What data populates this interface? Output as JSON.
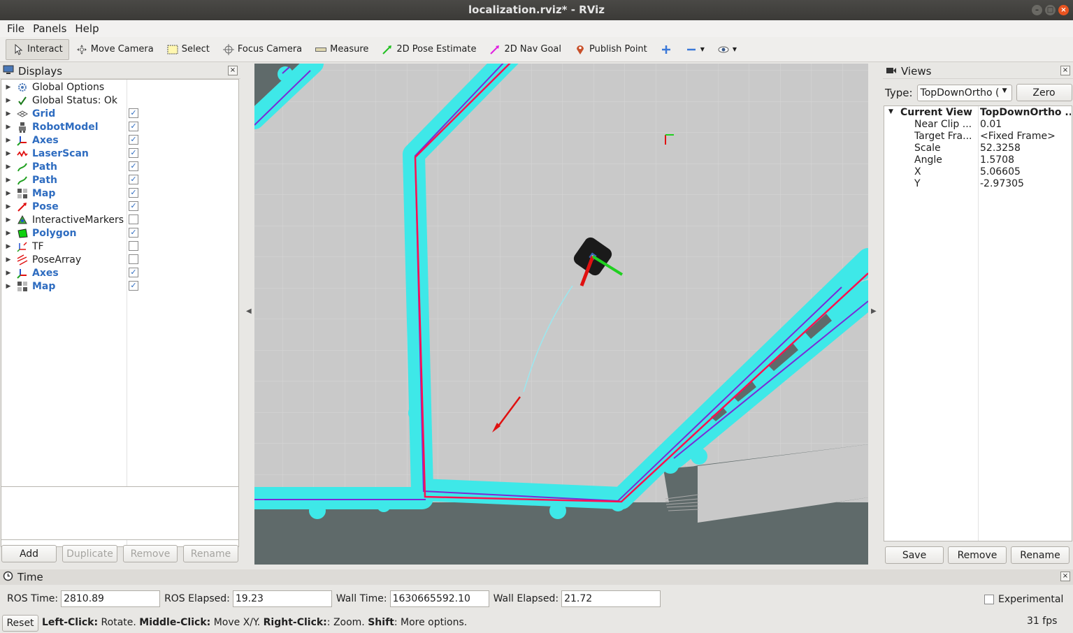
{
  "window": {
    "title": "localization.rviz* - RViz"
  },
  "menu": [
    "File",
    "Panels",
    "Help"
  ],
  "toolbar": {
    "tools": [
      {
        "label": "Interact",
        "icon": "cursor-icon",
        "active": true
      },
      {
        "label": "Move Camera",
        "icon": "move-camera-icon"
      },
      {
        "label": "Select",
        "icon": "select-box-icon"
      },
      {
        "label": "Focus Camera",
        "icon": "focus-camera-icon"
      },
      {
        "label": "Measure",
        "icon": "ruler-icon"
      },
      {
        "label": "2D Pose Estimate",
        "icon": "pose-estimate-arrow-icon"
      },
      {
        "label": "2D Nav Goal",
        "icon": "nav-goal-arrow-icon"
      },
      {
        "label": "Publish Point",
        "icon": "map-pin-icon"
      }
    ]
  },
  "displays": {
    "title": "Displays",
    "items": [
      {
        "label": "Global Options",
        "icon": "gear-icon",
        "bold": false,
        "checkbox": null
      },
      {
        "label": "Global Status: Ok",
        "icon": "check-icon",
        "bold": false,
        "checkbox": null
      },
      {
        "label": "Grid",
        "icon": "grid-icon",
        "bold": true,
        "checkbox": true
      },
      {
        "label": "RobotModel",
        "icon": "robot-icon",
        "bold": true,
        "checkbox": true
      },
      {
        "label": "Axes",
        "icon": "axes-icon",
        "bold": true,
        "checkbox": true
      },
      {
        "label": "LaserScan",
        "icon": "laser-icon",
        "bold": true,
        "checkbox": true
      },
      {
        "label": "Path",
        "icon": "path-icon",
        "bold": true,
        "checkbox": true
      },
      {
        "label": "Path",
        "icon": "path-icon",
        "bold": true,
        "checkbox": true
      },
      {
        "label": "Map",
        "icon": "map-icon",
        "bold": true,
        "checkbox": true
      },
      {
        "label": "Pose",
        "icon": "pose-arrow-icon",
        "bold": true,
        "checkbox": true
      },
      {
        "label": "InteractiveMarkers",
        "icon": "interactive-markers-icon",
        "bold": false,
        "checkbox": false
      },
      {
        "label": "Polygon",
        "icon": "polygon-icon",
        "bold": true,
        "checkbox": true
      },
      {
        "label": "TF",
        "icon": "tf-icon",
        "bold": false,
        "checkbox": false
      },
      {
        "label": "PoseArray",
        "icon": "pose-array-icon",
        "bold": false,
        "checkbox": false
      },
      {
        "label": "Axes",
        "icon": "axes-icon",
        "bold": true,
        "checkbox": true
      },
      {
        "label": "Map",
        "icon": "map-icon",
        "bold": true,
        "checkbox": true
      }
    ],
    "buttons": {
      "add": "Add",
      "duplicate": "Duplicate",
      "remove": "Remove",
      "rename": "Rename"
    }
  },
  "views": {
    "title": "Views",
    "type_label": "Type:",
    "type_value": "TopDownOrtho (",
    "zero": "Zero",
    "current_view": {
      "key": "Current View",
      "value": "TopDownOrtho ..."
    },
    "props": [
      {
        "key": "Near Clip ...",
        "value": "0.01"
      },
      {
        "key": "Target Fra...",
        "value": "<Fixed Frame>"
      },
      {
        "key": "Scale",
        "value": "52.3258"
      },
      {
        "key": "Angle",
        "value": "1.5708"
      },
      {
        "key": "X",
        "value": "5.06605"
      },
      {
        "key": "Y",
        "value": "-2.97305"
      }
    ],
    "buttons": {
      "save": "Save",
      "remove": "Remove",
      "rename": "Rename"
    }
  },
  "time": {
    "title": "Time",
    "ros_time_label": "ROS Time:",
    "ros_time": "2810.89",
    "ros_elapsed_label": "ROS Elapsed:",
    "ros_elapsed": "19.23",
    "wall_time_label": "Wall Time:",
    "wall_time": "1630665592.10",
    "wall_elapsed_label": "Wall Elapsed:",
    "wall_elapsed": "21.72",
    "experimental": "Experimental",
    "reset": "Reset",
    "hint": {
      "lc": "Left-Click:",
      "lc_t": " Rotate. ",
      "mc": "Middle-Click:",
      "mc_t": " Move X/Y. ",
      "rc": "Right-Click:",
      "rc_t": ": Zoom. ",
      "sh": "Shift",
      "sh_t": ": More options."
    },
    "fps": "31 fps"
  },
  "colors": {
    "costmap": "#3ee8e8",
    "obstacle": "#7a2bd6",
    "path": "#ff1050",
    "map_free": "#c9c9c9",
    "map_unknown": "#5f6a6a",
    "link": "#2e6cc0"
  }
}
